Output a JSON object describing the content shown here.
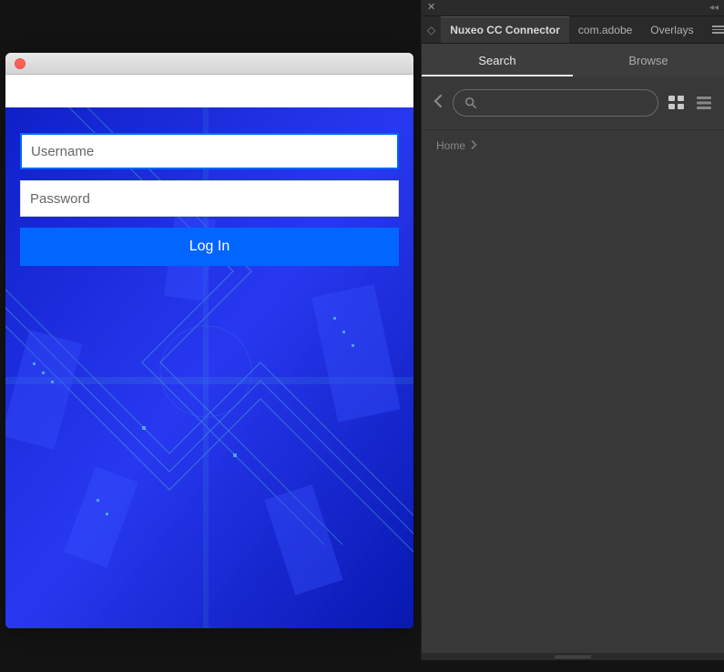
{
  "login": {
    "username_placeholder": "Username",
    "password_placeholder": "Password",
    "button_label": "Log In"
  },
  "panel": {
    "tabs": [
      {
        "label": "Nuxeo CC Connector",
        "active": true
      },
      {
        "label": "com.adobe",
        "active": false
      },
      {
        "label": "Overlays",
        "active": false
      }
    ],
    "sub_tabs": {
      "search": "Search",
      "browse": "Browse"
    },
    "breadcrumb": {
      "home": "Home"
    }
  }
}
